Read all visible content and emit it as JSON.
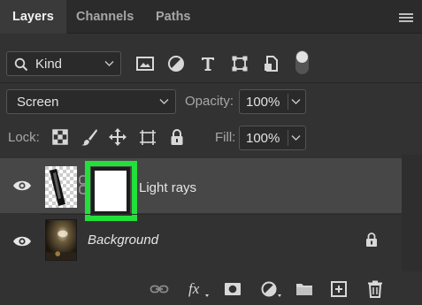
{
  "tabs": [
    {
      "label": "Layers",
      "active": true
    },
    {
      "label": "Channels",
      "active": false
    },
    {
      "label": "Paths",
      "active": false
    }
  ],
  "filter": {
    "kind_label": "Kind",
    "icons": [
      "image-filter-icon",
      "adjustment-filter-icon",
      "type-filter-icon",
      "shape-filter-icon",
      "smart-object-filter-icon"
    ]
  },
  "blend_mode": {
    "value": "Screen"
  },
  "opacity": {
    "label": "Opacity:",
    "value": "100%"
  },
  "lock": {
    "label": "Lock:",
    "icons": [
      "lock-transparent-pixels-icon",
      "lock-image-pixels-icon",
      "lock-position-icon",
      "prevent-autonest-icon",
      "lock-all-icon"
    ]
  },
  "fill": {
    "label": "Fill:",
    "value": "100%"
  },
  "layers": [
    {
      "name": "Light rays",
      "visible": true,
      "selected": true,
      "has_mask": true,
      "mask_highlight_color": "#22e03a"
    },
    {
      "name": "Background",
      "visible": true,
      "selected": false,
      "locked": true
    }
  ],
  "bottom_actions": [
    "link-layers-icon",
    "fx-icon",
    "add-mask-icon",
    "adjustment-layer-icon",
    "group-folder-icon",
    "new-layer-icon",
    "trash-icon"
  ],
  "colors": {
    "panel_bg": "#323232",
    "selected_row": "#474747",
    "highlight": "#22e03a"
  }
}
